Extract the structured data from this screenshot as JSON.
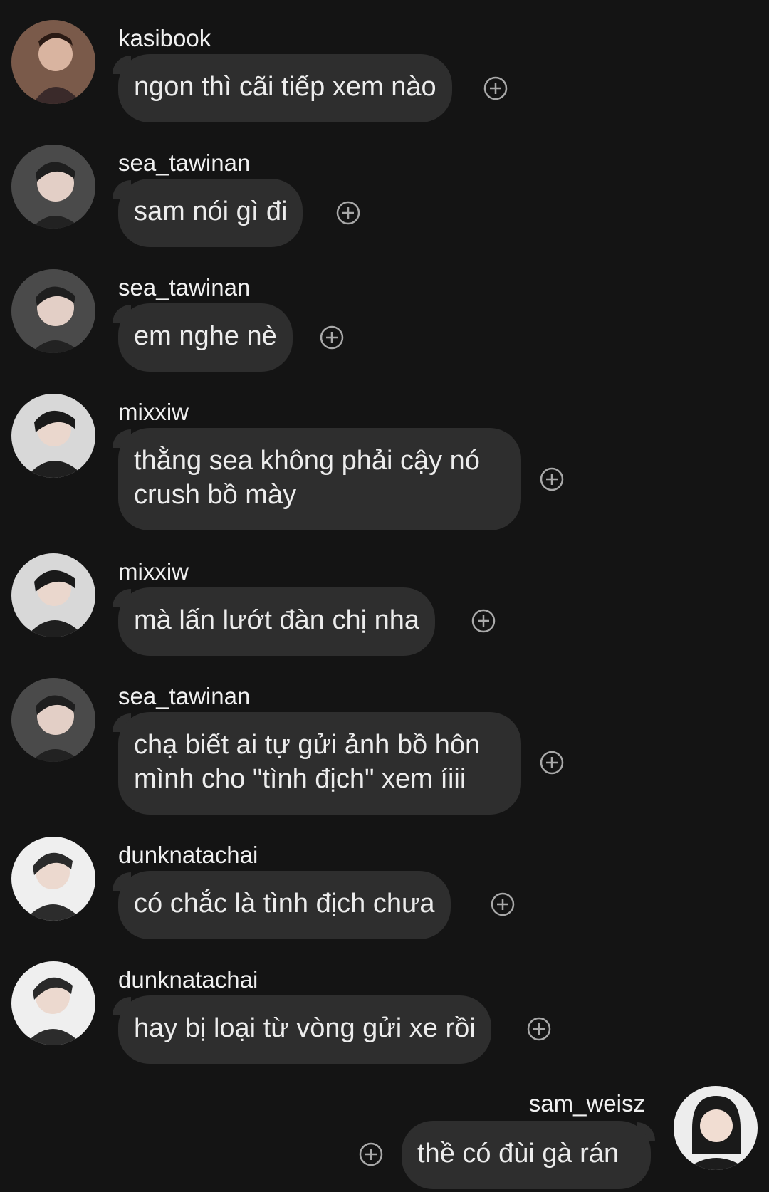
{
  "messages": [
    {
      "user": "kasibook",
      "text": "ngon thì cãi tiếp xem nào",
      "avatar": "avatar-kasibook"
    },
    {
      "user": "sea_tawinan",
      "text": "sam nói gì đi",
      "avatar": "avatar-sea"
    },
    {
      "user": "sea_tawinan",
      "text": "em nghe nè",
      "avatar": "avatar-sea"
    },
    {
      "user": "mixxiw",
      "text": "thằng sea không phải cậy nó crush bồ mày",
      "avatar": "avatar-mixxiw"
    },
    {
      "user": "mixxiw",
      "text": "mà lấn lướt đàn chị nha",
      "avatar": "avatar-mixxiw"
    },
    {
      "user": "sea_tawinan",
      "text": "chạ biết ai tự gửi ảnh bồ hôn mình cho \"tình địch\" xem íiii",
      "avatar": "avatar-sea"
    },
    {
      "user": "dunknatachai",
      "text": "có chắc là tình địch chưa",
      "avatar": "avatar-dunk"
    },
    {
      "user": "dunknatachai",
      "text": "hay bị loại từ vòng gửi xe rồi",
      "avatar": "avatar-dunk"
    },
    {
      "user": "sam_weisz",
      "text": "thề có đùi gà rán",
      "avatar": "avatar-sam",
      "self": true
    }
  ],
  "icons": {
    "react": "add-reaction-icon"
  },
  "colors": {
    "background": "#141414",
    "bubble": "#2e2e2e",
    "text": "#ececec",
    "icon": "#a9a9a9"
  }
}
